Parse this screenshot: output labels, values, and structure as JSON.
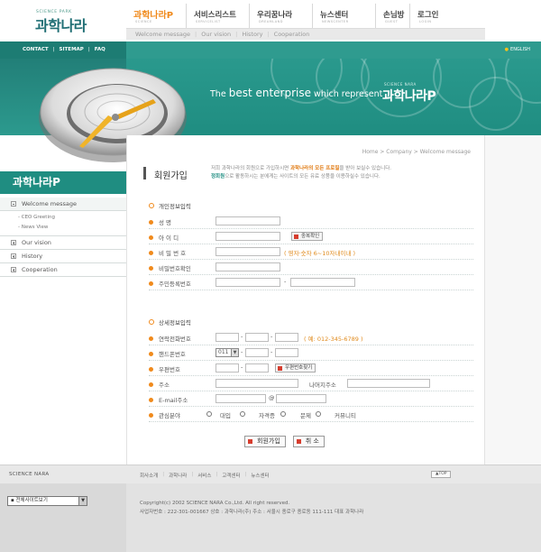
{
  "logo": {
    "tagline": "SCIENCE PARK",
    "name": "과학나라"
  },
  "gnb": [
    {
      "label": "과학나라P",
      "sub": "SCIENCE",
      "width": 66
    },
    {
      "label": "서비스리스트",
      "sub": "SERVICELIST",
      "width": 70
    },
    {
      "label": "우리꿈나라",
      "sub": "DREAMLAND",
      "width": 70
    },
    {
      "label": "뉴스센터",
      "sub": "NEWSCENTER",
      "width": 70
    },
    {
      "label": "손님방",
      "sub": "GUEST",
      "width": 38
    },
    {
      "label": "로그인",
      "sub": "LOGIN",
      "width": 50
    }
  ],
  "subnav": [
    "Welcome message",
    "Our vision",
    "History",
    "Cooperation"
  ],
  "toplinks": [
    "CONTACT",
    "SITEMAP",
    "FAQ"
  ],
  "english": "ENGLISH",
  "hero": {
    "pre": "The",
    "best": "best enterprise",
    "post": "which represent",
    "brand_small": "SCIENCE NARA",
    "brand": "과학나라P"
  },
  "left_title": "과학나라P",
  "lnb": {
    "welcome": "Welcome message",
    "subs": [
      "CEO Greeting",
      "News View"
    ],
    "vision": "Our vision",
    "history": "History",
    "coop": "Cooperation"
  },
  "breadcrumb": "Home > Company > Welcome message",
  "page_title": "회원가입",
  "intro": {
    "line1a": "저희 과학나라의 회원으로 가입하시면 ",
    "line1b": "과학나라의 모든 프로필",
    "line1c": "을 받아 보실수 있습니다.",
    "line2a": "정회원",
    "line2b": "으로 활동하시는 분에게는 사이트의 모든 유료 상품을 이용하실수 있습니다."
  },
  "section1": "개인정보입력",
  "fields1": {
    "name": "성      명",
    "id": "아 이 디",
    "pw": "비 밀 번 호",
    "pw2": "비밀번호확인",
    "jumin": "주민등록번호",
    "dup_btn": "중복확인",
    "pw_hint": "( 영자·숫자 6~10자내이내 )"
  },
  "section2": "상세정보입력",
  "fields2": {
    "phone": "연락전화번호",
    "phone_hint": "( 예: 012-345-6789 )",
    "mobile": "핸드폰번호",
    "mobile_prefix": "011",
    "zip": "우편번호",
    "zip_btn": "우편번호찾기",
    "addr": "주소",
    "addr_rest": "나머지주소",
    "email": "E-mail주소",
    "at": "@",
    "interest": "관심분야",
    "options": [
      "대입",
      "자격증",
      "문제",
      "커뮤니티"
    ]
  },
  "buttons": {
    "join": "회원가입",
    "cancel": "취  소"
  },
  "footer": {
    "brand": "SCIENCE NARA",
    "links": [
      "회사소개",
      "과학나라",
      "서비스",
      "고객센터",
      "뉴스센터"
    ],
    "top": "▲TOP",
    "sitemap": "▪ 전체사이트보기",
    "copy1": "Copyright(c) 2002 SCIENCE NARA Co.,Ltd. All right reserved.",
    "copy2": "사업자번호 : 222-301-001667 상호 : 과학나라(주)  주소 : 서울시 종로구 종로동 111-111 대표 과학나라"
  },
  "colors": {
    "teal": "#2f9b8f",
    "teal_dark": "#1d7c73",
    "orange": "#f08a1c"
  }
}
